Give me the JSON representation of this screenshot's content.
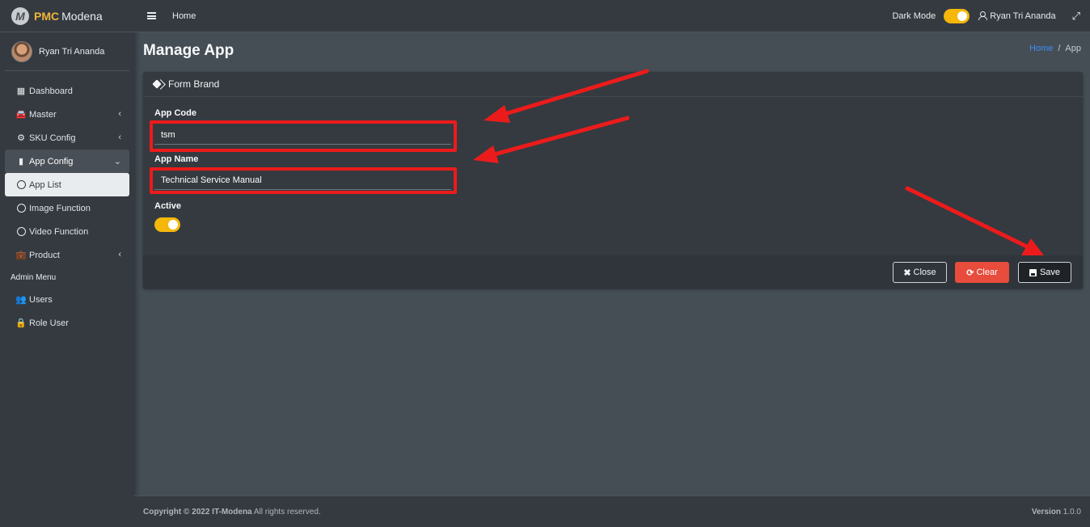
{
  "brand": {
    "logo_letter": "M",
    "name_bold": "PMC",
    "name_rest": "Modena"
  },
  "sidebar": {
    "user_name": "Ryan Tri Ananda",
    "items": [
      {
        "label": "Dashboard",
        "icon": "grid-icon"
      },
      {
        "label": "Master",
        "icon": "car-icon"
      },
      {
        "label": "SKU Config",
        "icon": "gear-icon"
      },
      {
        "label": "App Config",
        "icon": "mobile-icon"
      },
      {
        "label": "App List",
        "icon": "circle-icon"
      },
      {
        "label": "Image Function",
        "icon": "circle-icon"
      },
      {
        "label": "Video Function",
        "icon": "circle-icon"
      },
      {
        "label": "Product",
        "icon": "briefcase-icon"
      }
    ],
    "admin_header": "Admin Menu",
    "admin_items": [
      {
        "label": "Users",
        "icon": "users-icon"
      },
      {
        "label": "Role User",
        "icon": "lock-icon"
      }
    ]
  },
  "navbar": {
    "home": "Home",
    "dark_mode_label": "Dark Mode",
    "dark_mode_on": true,
    "user": "Ryan Tri Ananda"
  },
  "page": {
    "title": "Manage App",
    "breadcrumb_home": "Home",
    "breadcrumb_current": "App"
  },
  "form": {
    "header": "Form Brand",
    "app_code_label": "App Code",
    "app_code_value": "tsm",
    "app_name_label": "App Name",
    "app_name_value": "Technical Service Manual",
    "active_label": "Active",
    "active_on": true
  },
  "buttons": {
    "close": "Close",
    "clear": "Clear",
    "save": "Save"
  },
  "footer": {
    "copyright_prefix": "Copyright © 2022",
    "company": "IT-Modena",
    "rights": "All rights reserved.",
    "version_label": "Version",
    "version_value": "1.0.0"
  },
  "colors": {
    "accent_yellow": "#f5b70a",
    "danger": "#e74c3c",
    "annotation_red": "#ec1b1b",
    "link_blue": "#3f8ff6"
  }
}
